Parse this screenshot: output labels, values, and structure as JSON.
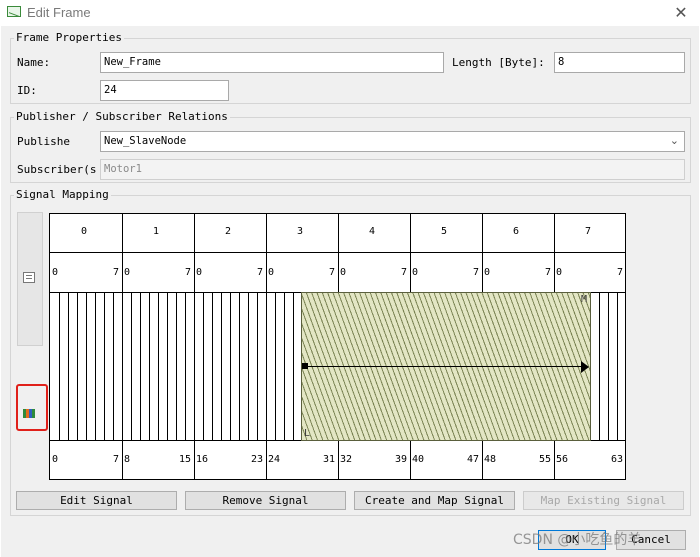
{
  "window": {
    "title": "Edit Frame",
    "close_glyph": "✕"
  },
  "frame_properties": {
    "legend": "Frame Properties",
    "name_label": "Name:",
    "name_value": "New_Frame",
    "length_label": "Length [Byte]:",
    "length_value": "8",
    "id_label": "ID:",
    "id_value": "24"
  },
  "relations": {
    "legend": "Publisher / Subscriber Relations",
    "publisher_label": "Publishe",
    "publisher_value": "New_SlaveNode",
    "subscriber_label": "Subscriber(s",
    "subscriber_value": "Motor1"
  },
  "mapping": {
    "legend": "Signal Mapping",
    "byte_labels": [
      "0",
      "1",
      "2",
      "3",
      "4",
      "5",
      "6",
      "7"
    ],
    "bit_first": "0",
    "bit_last": "7",
    "signal_msb_marker": "M",
    "signal_lsb_marker": "L",
    "bit_offsets": [
      "0",
      "7",
      "8",
      "15",
      "16",
      "23",
      "24",
      "31",
      "32",
      "39",
      "40",
      "47",
      "48",
      "55",
      "56",
      "63"
    ]
  },
  "buttons": {
    "edit_signal": "Edit Signal",
    "remove_signal": "Remove Signal",
    "create_map": "Create and Map Signal",
    "map_existing": "Map Existing Signal",
    "ok": "OK",
    "cancel": "Cancel"
  },
  "watermark": "CSDN @小吃鱼的羊"
}
